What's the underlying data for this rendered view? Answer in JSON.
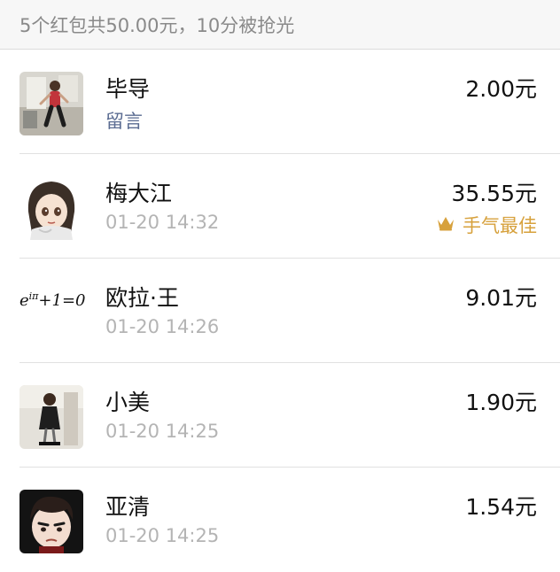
{
  "summary": "5个红包共50.00元，10分被抢光",
  "entries": [
    {
      "name": "毕导",
      "sub": "留言",
      "amount": "2.00元",
      "avatar": "photo-person-avatar"
    },
    {
      "name": "梅大江",
      "sub": "01-20 14:32",
      "amount": "35.55元",
      "best": "手气最佳",
      "avatar": "anime-girl-avatar"
    },
    {
      "name": "欧拉·王",
      "sub": "01-20 14:26",
      "amount": "9.01元",
      "avatar": "euler-formula-avatar"
    },
    {
      "name": "小美",
      "sub": "01-20 14:25",
      "amount": "1.90元",
      "avatar": "photo-woman-avatar"
    },
    {
      "name": "亚清",
      "sub": "01-20 14:25",
      "amount": "1.54元",
      "avatar": "cartoon-boy-avatar"
    }
  ],
  "euler_formula": {
    "base": "e",
    "exponent": "iπ",
    "rest": "+1=0"
  },
  "colors": {
    "best_gold": "#d7a13c",
    "link": "#5b6c92",
    "timestamp": "#b4b4b4"
  }
}
